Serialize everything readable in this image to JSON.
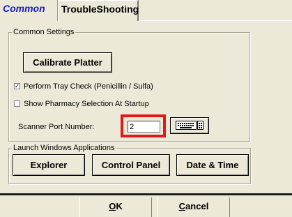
{
  "tabs": {
    "common": "Common",
    "troubleshooting": "TroubleShooting"
  },
  "common_settings": {
    "legend": "Common Settings",
    "calibrate_label": "Calibrate Platter",
    "tray_check_label": "Perform Tray Check (Penicillin / Sulfa)",
    "tray_check_checked": true,
    "pharmacy_label": "Show Pharmacy Selection At Startup",
    "pharmacy_checked": false,
    "scanner_label": "Scanner Port Number:",
    "scanner_value": "2",
    "keyboard_icon": "keyboard-icon"
  },
  "launch": {
    "legend": "Launch Windows Applications",
    "explorer_label": "Explorer",
    "control_panel_label": "Control Panel",
    "date_time_label": "Date & Time"
  },
  "footer": {
    "ok_label": "OK",
    "cancel_label": "Cancel"
  },
  "colors": {
    "background": "#ece9d8",
    "active_tab_text": "#1a1acb",
    "highlight": "#e01a1a"
  }
}
